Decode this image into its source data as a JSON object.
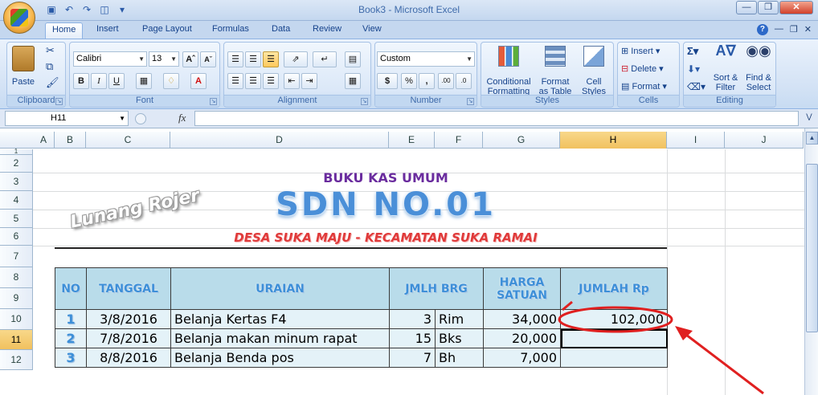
{
  "window": {
    "title": "Book3 - Microsoft Excel"
  },
  "tabs": [
    "Home",
    "Insert",
    "Page Layout",
    "Formulas",
    "Data",
    "Review",
    "View"
  ],
  "ribbon": {
    "clipboard": {
      "label": "Clipboard",
      "paste": "Paste"
    },
    "font": {
      "label": "Font",
      "name": "Calibri",
      "size": "13"
    },
    "alignment": {
      "label": "Alignment"
    },
    "number": {
      "label": "Number",
      "format": "Custom"
    },
    "styles": {
      "label": "Styles",
      "conditional_1": "Conditional",
      "conditional_2": "Formatting",
      "format_1": "Format",
      "format_2": "as Table",
      "cell_1": "Cell",
      "cell_2": "Styles"
    },
    "cells": {
      "label": "Cells",
      "insert": "Insert",
      "delete": "Delete",
      "format": "Format"
    },
    "editing": {
      "label": "Editing",
      "sort_1": "Sort &",
      "sort_2": "Filter",
      "find_1": "Find &",
      "find_2": "Select"
    }
  },
  "formula_bar": {
    "name_box": "H11",
    "fx": "fx",
    "formula": ""
  },
  "columns": [
    "A",
    "B",
    "C",
    "D",
    "E",
    "F",
    "G",
    "H",
    "I",
    "J"
  ],
  "rows": [
    "1",
    "2",
    "3",
    "4",
    "5",
    "6",
    "7",
    "8",
    "9",
    "10",
    "11",
    "12"
  ],
  "document": {
    "heading": "BUKU KAS UMUM",
    "school": "SDN NO.01",
    "location": "DESA SUKA MAJU - KECAMATAN SUKA RAMAI",
    "watermark": "Lunang Rojer",
    "headers": {
      "no": "NO",
      "tanggal": "TANGGAL",
      "uraian": "URAIAN",
      "jmlh": "JMLH BRG",
      "harga_1": "HARGA",
      "harga_2": "SATUAN",
      "jumlah": "JUMLAH Rp"
    },
    "items": [
      {
        "no": "1",
        "tanggal": "3/8/2016",
        "uraian": "Belanja Kertas F4",
        "qty": "3",
        "unit": "Rim",
        "harga": "34,000",
        "jumlah": "102,000"
      },
      {
        "no": "2",
        "tanggal": "7/8/2016",
        "uraian": "Belanja makan minum rapat",
        "qty": "15",
        "unit": "Bks",
        "harga": "20,000",
        "jumlah": ""
      },
      {
        "no": "3",
        "tanggal": "8/8/2016",
        "uraian": "Belanja Benda pos",
        "qty": "7",
        "unit": "Bh",
        "harga": "7,000",
        "jumlah": ""
      }
    ]
  },
  "colors": {
    "accent": "#15428b",
    "selection": "#f1c15f",
    "annotation": "#e02020"
  }
}
